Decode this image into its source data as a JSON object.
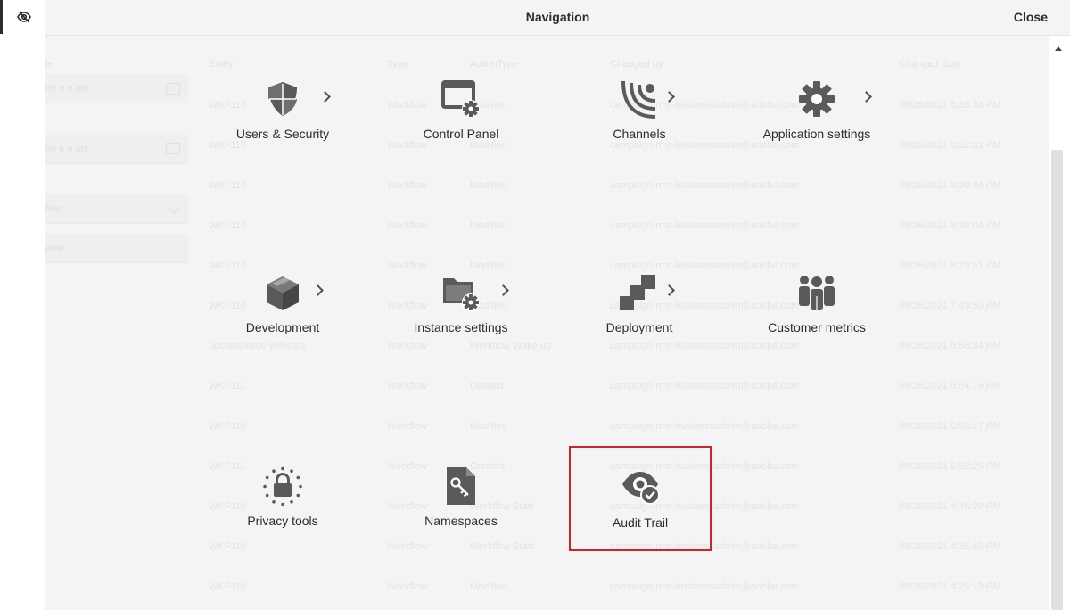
{
  "header": {
    "title": "Navigation",
    "close_label": "Close"
  },
  "rail": {
    "icon": "eye-off-icon"
  },
  "tiles": [
    {
      "label": "Users & Security",
      "icon": "shield-icon",
      "has_submenu": true
    },
    {
      "label": "Control Panel",
      "icon": "control-panel-icon",
      "has_submenu": false
    },
    {
      "label": "Channels",
      "icon": "broadcast-icon",
      "has_submenu": true
    },
    {
      "label": "Application settings",
      "icon": "gear-icon",
      "has_submenu": true
    },
    {
      "label": "Development",
      "icon": "cubes-icon",
      "has_submenu": true
    },
    {
      "label": "Instance settings",
      "icon": "folder-gear-icon",
      "has_submenu": true
    },
    {
      "label": "Deployment",
      "icon": "deployment-icon",
      "has_submenu": true
    },
    {
      "label": "Customer metrics",
      "icon": "users-group-icon",
      "has_submenu": false
    },
    {
      "label": "Privacy tools",
      "icon": "privacy-lock-icon",
      "has_submenu": false
    },
    {
      "label": "Namespaces",
      "icon": "document-key-icon",
      "has_submenu": false
    },
    {
      "label": "Audit Trail",
      "icon": "eye-check-icon",
      "has_submenu": false,
      "selected": true
    }
  ],
  "background": {
    "filters": {
      "labels": [
        "le",
        "",
        ""
      ],
      "inputs": [
        "ne e   e  ate",
        "",
        "flow",
        "ame"
      ]
    },
    "table": {
      "columns": [
        "Entity",
        "Type",
        "ActionType",
        "Changed by",
        "Changed date"
      ],
      "rows": [
        [
          "WKF110",
          "Workflow",
          "Modified",
          "campaign-rms-businessadmin@adobe.com",
          "08/26/2021 8:33:33 PM"
        ],
        [
          "WKF110",
          "Workflow",
          "Modified",
          "campaign-rms-businessadmin@adobe.com",
          "08/26/2021 8:32:31 PM"
        ],
        [
          "WKF110",
          "Workflow",
          "Modified",
          "campaign-rms-businessadmin@adobe.com",
          "08/26/2021 8:30:44 PM"
        ],
        [
          "WKF110",
          "Workflow",
          "Modified",
          "campaign-rms-businessadmin@adobe.com",
          "08/26/2021 8:30:04 PM"
        ],
        [
          "WKF110",
          "Workflow",
          "Modified",
          "campaign-rms-businessadmin@adobe.com",
          "08/26/2021 8:29:51 PM"
        ],
        [
          "WKF110",
          "Workflow",
          "Modified",
          "campaign-rms-businessadmin@adobe.com",
          "08/26/2021 7:43:50 PM"
        ],
        [
          "updateDeliveryMetrics",
          "Workflow",
          "Workflow Wake up",
          "campaign-rms-businessadmin@adobe.com",
          "08/26/2021 6:58:34 PM"
        ],
        [
          "WKF111",
          "Workflow",
          "Deleted",
          "campaign-rms-businessadmin@adobe.com",
          "08/26/2021 6:54:16 PM"
        ],
        [
          "WKF110",
          "Workflow",
          "Modified",
          "campaign-rms-businessadmin@adobe.com",
          "08/26/2021 6:53:17 PM"
        ],
        [
          "WKF111",
          "Workflow",
          "Created",
          "campaign-rms-businessadmin@adobe.com",
          "08/26/2021 6:52:25 PM"
        ],
        [
          "WKF110",
          "Workflow",
          "Workflow Start",
          "campaign-rms-businessadmin@adobe.com",
          "08/26/2021 4:45:29 PM"
        ],
        [
          "WKF110",
          "Workflow",
          "Workflow Start",
          "campaign-rms-businessadmin@adobe.com",
          "08/26/2021 4:35:45 PM"
        ],
        [
          "WKF110",
          "Workflow",
          "Modified",
          "campaign-rms-businessadmin@adobe.com",
          "08/26/2021 4:25:19 PM"
        ]
      ]
    }
  }
}
